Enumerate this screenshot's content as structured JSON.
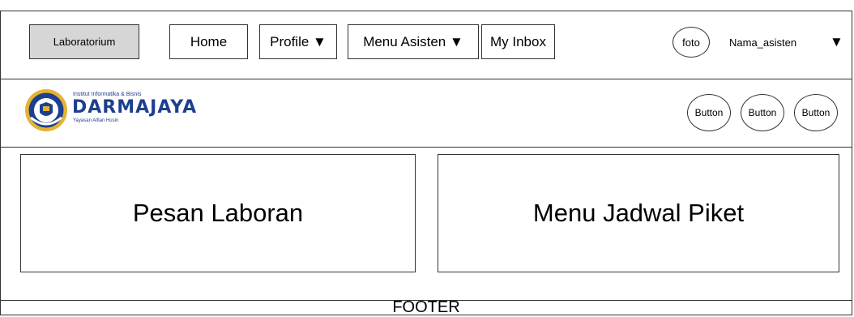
{
  "nav": {
    "brand_label": "Laboratorium",
    "items": [
      {
        "label": "Home"
      },
      {
        "label": "Profile ▼"
      },
      {
        "label": "Menu Asisten ▼"
      },
      {
        "label": "My Inbox"
      }
    ],
    "avatar_label": "foto",
    "username": "Nama_asisten",
    "user_menu_arrow": "▼"
  },
  "logo": {
    "institute": "Institut Informatika & Bisnis",
    "name": "DARMAJAYA",
    "foundation": "Yayasan Alfian Husin",
    "seal_text": "DARMAJAYA",
    "brand_color": "#1d3f8f",
    "seal_gold": "#e4b332"
  },
  "header": {
    "buttons": [
      "Button",
      "Button",
      "Button"
    ]
  },
  "main": {
    "cards": [
      {
        "title": "Pesan Laboran"
      },
      {
        "title": "Menu Jadwal Piket"
      }
    ]
  },
  "footer": {
    "label": "FOOTER"
  }
}
